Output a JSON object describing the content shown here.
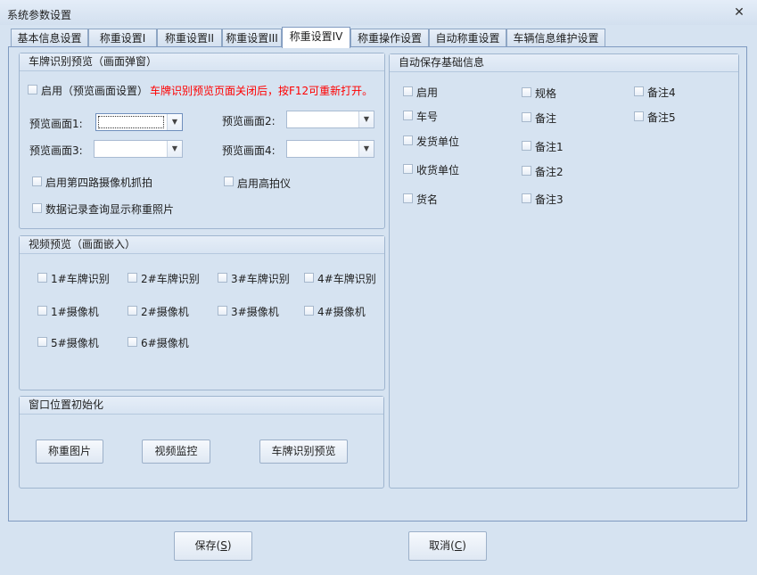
{
  "window": {
    "title": "系统参数设置",
    "close_icon": "close-icon"
  },
  "tabs": [
    {
      "label": "基本信息设置"
    },
    {
      "label": "称重设置I"
    },
    {
      "label": "称重设置II"
    },
    {
      "label": "称重设置III"
    },
    {
      "label": "称重设置IV",
      "active": true
    },
    {
      "label": "称重操作设置"
    },
    {
      "label": "自动称重设置"
    },
    {
      "label": "车辆信息维护设置"
    }
  ],
  "plate_preview": {
    "title": "车牌识别预览（画面弹窗）",
    "enable_label": "启用（预览画面设置）",
    "notice": "车牌识别预览页面关闭后，按F12可重新打开。",
    "screen1_label": "预览画面1:",
    "screen2_label": "预览画面2:",
    "screen3_label": "预览画面3:",
    "screen4_label": "预览画面4:",
    "screen1_value": "",
    "screen2_value": "",
    "screen3_value": "",
    "screen4_value": "",
    "fourth_camera_label": "启用第四路摄像机抓拍",
    "high_camera_label": "启用高拍仪",
    "record_photo_label": "数据记录查询显示称重照片"
  },
  "video_preview": {
    "title": "视频预览（画面嵌入）",
    "items": [
      {
        "label": "1#车牌识别"
      },
      {
        "label": "2#车牌识别"
      },
      {
        "label": "3#车牌识别"
      },
      {
        "label": "4#车牌识别"
      },
      {
        "label": "1#摄像机"
      },
      {
        "label": "2#摄像机"
      },
      {
        "label": "3#摄像机"
      },
      {
        "label": "4#摄像机"
      },
      {
        "label": "5#摄像机"
      },
      {
        "label": "6#摄像机"
      }
    ]
  },
  "window_pos": {
    "title": "窗口位置初始化",
    "btn_weigh_image": "称重图片",
    "btn_video_monitor": "视频监控",
    "btn_plate_preview": "车牌识别预览"
  },
  "auto_save": {
    "title": "自动保存基础信息",
    "items": [
      {
        "label": "启用"
      },
      {
        "label": "车号"
      },
      {
        "label": "发货单位"
      },
      {
        "label": "收货单位"
      },
      {
        "label": "货名"
      },
      {
        "label": "规格"
      },
      {
        "label": "备注"
      },
      {
        "label": "备注1"
      },
      {
        "label": "备注2"
      },
      {
        "label": "备注3"
      },
      {
        "label": "备注4"
      },
      {
        "label": "备注5"
      }
    ]
  },
  "footer": {
    "save_prefix": "保存(",
    "save_key": "S",
    "save_suffix": ")",
    "cancel_prefix": "取消(",
    "cancel_key": "C",
    "cancel_suffix": ")"
  }
}
